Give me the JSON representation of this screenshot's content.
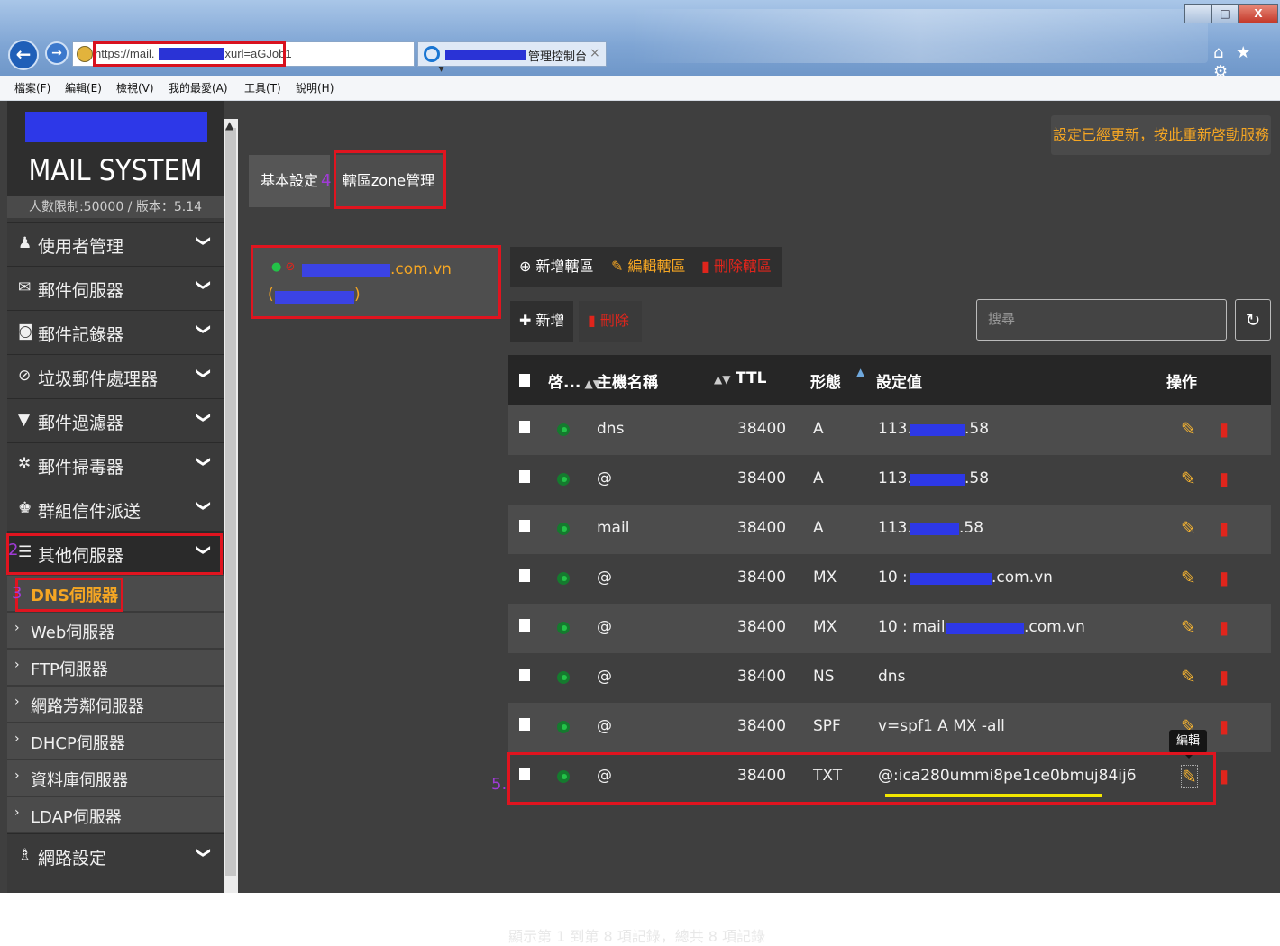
{
  "browser": {
    "address_url": "https://mail.          .com.vn:88 ?xurl=aGJob1",
    "address_icons": "ρ ▾ ¢",
    "tab_title": "管理控制台",
    "tab_close": "×",
    "win_min": "–",
    "win_max": "□",
    "win_close": "X",
    "right_icons": "⌂ ★ ⚙",
    "menu": [
      "檔案(F)",
      "編輯(E)",
      "檢視(V)",
      "我的最愛(A)",
      "工具(T)",
      "說明(H)"
    ]
  },
  "sidebar": {
    "system_title": "MAIL SYSTEM",
    "system_sub": "人數限制:50000 / 版本：5.14",
    "items": [
      {
        "icon": "user-icon",
        "glyph": "♟",
        "label": "使用者管理"
      },
      {
        "icon": "envelope-icon",
        "glyph": "✉",
        "label": "郵件伺服器"
      },
      {
        "icon": "camera-icon",
        "glyph": "◙",
        "label": "郵件記錄器"
      },
      {
        "icon": "ban-icon",
        "glyph": "⊘",
        "label": "垃圾郵件處理器"
      },
      {
        "icon": "filter-icon",
        "glyph": "▼",
        "label": "郵件過濾器"
      },
      {
        "icon": "bug-icon",
        "glyph": "✲",
        "label": "郵件掃毒器"
      },
      {
        "icon": "group-icon",
        "glyph": "♚",
        "label": "群組信件派送"
      },
      {
        "icon": "server-icon",
        "glyph": "☰",
        "label": "其他伺服器"
      }
    ],
    "sub_items": [
      "DNS伺服器",
      "Web伺服器",
      "FTP伺服器",
      "網路芳鄰伺服器",
      "DHCP伺服器",
      "資料庫伺服器",
      "LDAP伺服器"
    ],
    "network": {
      "icon": "sitemap-icon",
      "glyph": "♗",
      "label": "網路設定"
    },
    "chevron": "❯",
    "sub_arrow": "›"
  },
  "notice": "設定已經更新，按此重新啓動服務",
  "tabs": {
    "basic": "基本設定",
    "zone": "轄區zone管理"
  },
  "zone": {
    "domain": ".com.vn",
    "paren_open": "(",
    "paren_close": ")"
  },
  "zone_actions": {
    "add": "新增轄區",
    "edit": "編輯轄區",
    "delete": "刪除轄區"
  },
  "record_actions": {
    "add": "新增",
    "delete": "刪除"
  },
  "search": {
    "placeholder": "搜尋",
    "refresh": "↻"
  },
  "table": {
    "headers": {
      "enable": "啓...",
      "host": "主機名稱",
      "ttl": "TTL",
      "type": "形態",
      "value": "設定值",
      "ops": "操作"
    },
    "rows": [
      {
        "host": "dns",
        "ttl": "38400",
        "type": "A",
        "value_pre": "113.",
        "value_post": ".58"
      },
      {
        "host": "@",
        "ttl": "38400",
        "type": "A",
        "value_pre": "113.",
        "value_post": ".58"
      },
      {
        "host": "mail",
        "ttl": "38400",
        "type": "A",
        "value_pre": "113.",
        "value_post": ".58"
      },
      {
        "host": "@",
        "ttl": "38400",
        "type": "MX",
        "value_pre": "10 :",
        "value_post": ".com.vn"
      },
      {
        "host": "@",
        "ttl": "38400",
        "type": "MX",
        "value_pre": "10 : mail.",
        "value_post": ".com.vn"
      },
      {
        "host": "@",
        "ttl": "38400",
        "type": "NS",
        "value_pre": "dns",
        "value_post": ""
      },
      {
        "host": "@",
        "ttl": "38400",
        "type": "SPF",
        "value_pre": "v=spf1 A MX -all",
        "value_post": ""
      },
      {
        "host": "@",
        "ttl": "38400",
        "type": "TXT",
        "value_pre": "@:ica280ummi8pe1ce0bmuj84ij6",
        "value_post": ""
      }
    ],
    "tooltip": "編輯"
  },
  "footer": "顯示第 1 到第 8 項記錄，總共 8 項記錄",
  "steps": {
    "s2": "2",
    "s3": "3",
    "s4": "4",
    "s5": "5."
  },
  "colors": {
    "accent": "#f5a623",
    "highlight": "#e0141f",
    "mask": "#2d38e8",
    "annotation": "#a03bd6"
  }
}
